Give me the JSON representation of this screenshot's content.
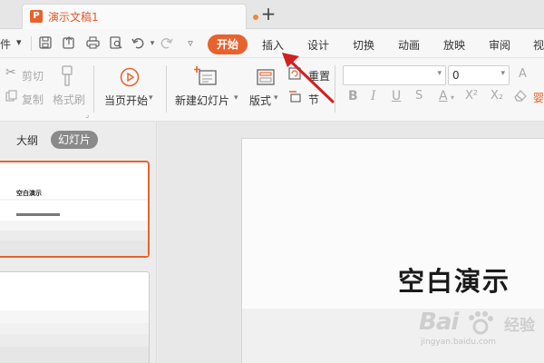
{
  "titlebar": {
    "doc_icon_letter": "P",
    "doc_title": "演示文稿1",
    "new_tab": "+"
  },
  "menubar": {
    "menu_glyph": "件",
    "tabs": [
      "开始",
      "插入",
      "设计",
      "切换",
      "动画",
      "放映",
      "审阅",
      "视"
    ],
    "active_tab": "开始"
  },
  "ribbon": {
    "cut": "剪切",
    "copy": "复制",
    "format_painter": "格式刷",
    "play_from_current": "当页开始",
    "new_slide": "新建幻灯片",
    "layout": "版式",
    "reset": "重置",
    "section": "节",
    "font_size_value": "0",
    "extra_label": "婴"
  },
  "left_panel": {
    "tabs": [
      "大纲",
      "幻灯片"
    ],
    "active_tab": "幻灯片",
    "thumb_title": "空白演示"
  },
  "slide": {
    "title": "空白演示"
  },
  "watermark": {
    "logo": "Bai",
    "logo2": "经验",
    "url": "jingyan.baidu.com"
  },
  "colors": {
    "accent": "#e8622d",
    "arrow": "#d21f1f"
  }
}
